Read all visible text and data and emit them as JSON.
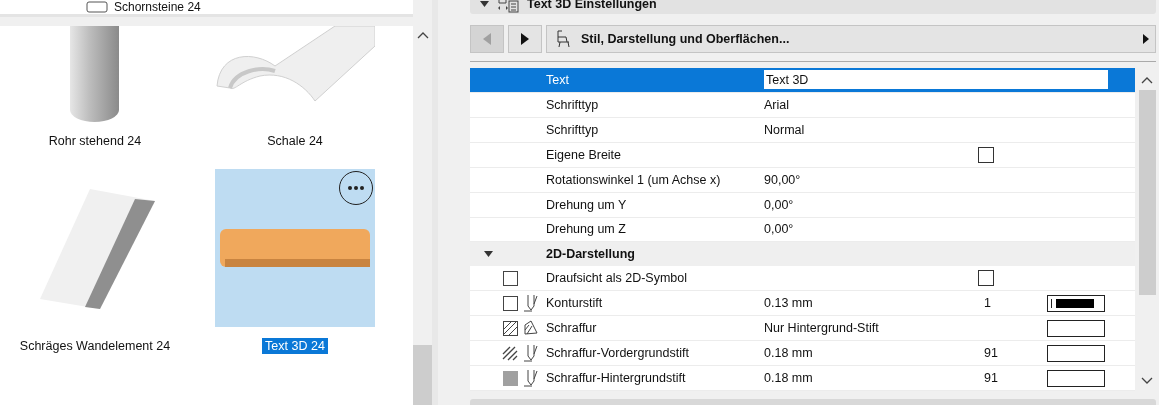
{
  "library": {
    "top_item": {
      "label": "Schornsteine 24"
    },
    "items": [
      {
        "label": "Rohr stehend 24",
        "kind": "cylinder",
        "selected": false
      },
      {
        "label": "Schale 24",
        "kind": "halfpipe",
        "selected": false
      },
      {
        "label": "Schräges Wandelement 24",
        "kind": "slab",
        "selected": false
      },
      {
        "label": "Text 3D 24",
        "kind": "text3d",
        "selected": true
      }
    ]
  },
  "settings": {
    "title": "Text 3D Einstellungen",
    "expanded": true,
    "nav": {
      "back_disabled": true,
      "forward_disabled": false,
      "page": "Stil, Darstellung und Oberflächen..."
    },
    "rows": [
      {
        "kind": "field",
        "label": "Text",
        "value": "Text 3D",
        "selected": true
      },
      {
        "kind": "param",
        "label": "Schrifttyp",
        "value": "Arial",
        "selected": false
      },
      {
        "kind": "param",
        "label": "Schrifttyp",
        "value": "Normal",
        "selected": false
      },
      {
        "kind": "check",
        "label": "Eigene Breite",
        "checked": false,
        "selected": false
      },
      {
        "kind": "param",
        "label": "Rotationswinkel 1 (um Achse x)",
        "value": "90,00°",
        "selected": false
      },
      {
        "kind": "param",
        "label": "Drehung um Y",
        "value": "0,00°",
        "selected": false
      },
      {
        "kind": "param",
        "label": "Drehung um Z",
        "value": "0,00°",
        "selected": false
      },
      {
        "kind": "section",
        "label": "2D-Darstellung",
        "expanded": true
      },
      {
        "kind": "check",
        "icons": [
          {
            "kind": "box"
          }
        ],
        "label": "Draufsicht als 2D-Symbol",
        "checked": false,
        "selected": false
      },
      {
        "kind": "pen",
        "icons": [
          {
            "kind": "box"
          },
          {
            "kind": "pen"
          }
        ],
        "label": "Konturstift",
        "value": "0.13 mm",
        "number": "1",
        "swatch": {
          "kind": "line"
        },
        "selected": false
      },
      {
        "kind": "pen",
        "icons": [
          {
            "kind": "hatch"
          },
          {
            "kind": "hatch-pen"
          }
        ],
        "label": "Schraffur",
        "value": "Nur Hintergrund-Stift",
        "swatch": {
          "kind": "empty"
        },
        "selected": false
      },
      {
        "kind": "pen",
        "icons": [
          {
            "kind": "stripes"
          },
          {
            "kind": "pen"
          }
        ],
        "label": "Schraffur-Vordergrundstift",
        "value": "0.18 mm",
        "number": "91",
        "swatch": {
          "kind": "empty"
        },
        "selected": false
      },
      {
        "kind": "pen",
        "icons": [
          {
            "kind": "solid"
          },
          {
            "kind": "pen"
          }
        ],
        "label": "Schraffur-Hintergrundstift",
        "value": "0.18 mm",
        "number": "91",
        "swatch": {
          "kind": "empty"
        },
        "selected": false
      }
    ]
  }
}
